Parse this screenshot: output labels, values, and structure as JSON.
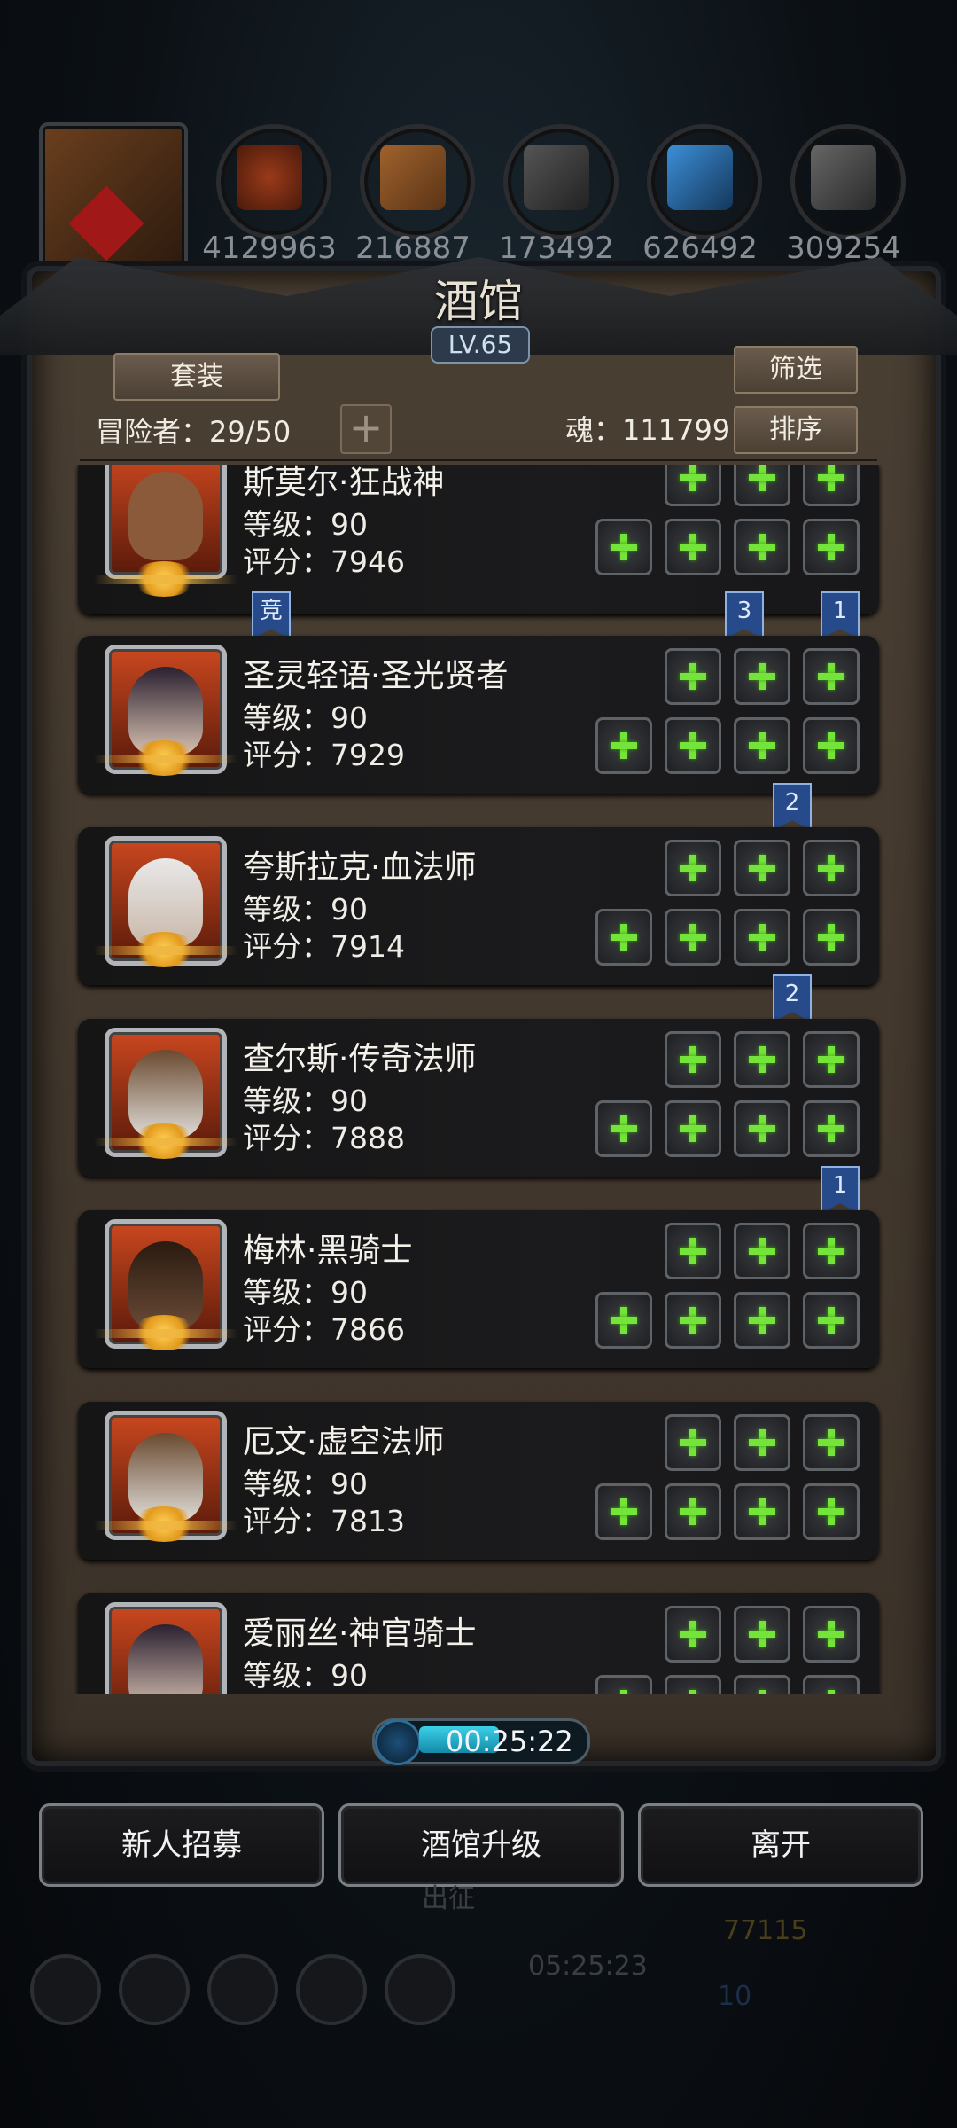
{
  "resources": [
    {
      "icon": "tiger-avatar-icon",
      "value": ""
    },
    {
      "icon": "meat-icon",
      "value": "4129963"
    },
    {
      "icon": "wood-icon",
      "value": "216887"
    },
    {
      "icon": "iron-icon",
      "value": "173492"
    },
    {
      "icon": "crystal-icon",
      "value": "626492"
    },
    {
      "icon": "ore-icon",
      "value": "309254"
    }
  ],
  "panel": {
    "title": "酒馆",
    "level": "LV.65",
    "set_label": "套装",
    "filter_label": "筛选",
    "sort_label": "排序",
    "adventurers": "冒险者：29/50",
    "soul": "魂：111799"
  },
  "heroes": [
    {
      "name": "斯莫尔·狂战神",
      "level": "等级：90",
      "score": "评分：7946"
    },
    {
      "name": "圣灵轻语·圣光贤者",
      "level": "等级：90",
      "score": "评分：7929"
    },
    {
      "name": "夸斯拉克·血法师",
      "level": "等级：90",
      "score": "评分：7914"
    },
    {
      "name": "查尔斯·传奇法师",
      "level": "等级：90",
      "score": "评分：7888"
    },
    {
      "name": "梅林·黑骑士",
      "level": "等级：90",
      "score": "评分：7866"
    },
    {
      "name": "厄文·虚空法师",
      "level": "等级：90",
      "score": "评分：7813"
    },
    {
      "name": "爱丽丝·神官骑士",
      "level": "等级：90",
      "score": ""
    }
  ],
  "tags": {
    "compete": "竞",
    "t1": "3",
    "t2": "1",
    "t3": "2",
    "t4": "2",
    "t5": "1"
  },
  "timer": "00:25:22",
  "buttons": {
    "recruit": "新人招募",
    "upgrade": "酒馆升级",
    "leave": "离开"
  },
  "background": {
    "expedition": "出征",
    "gold": "77115",
    "gem": "10",
    "gift_timer": "05:25:23"
  }
}
